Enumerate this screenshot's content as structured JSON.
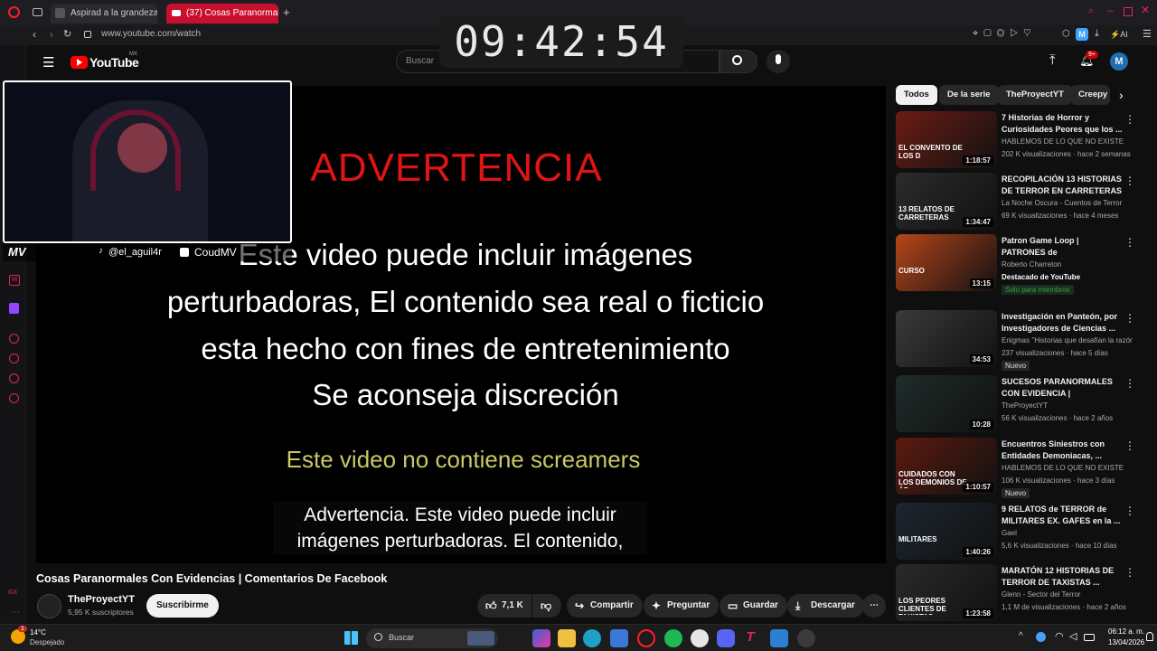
{
  "browser": {
    "tabs": [
      {
        "label": "Aspirad a la grandeza en A",
        "active": false
      },
      {
        "label": "(37) Cosas Paranormales",
        "active": true
      }
    ],
    "url": "www.youtube.com/watch",
    "ai_label": "AI"
  },
  "overlay": {
    "clock": "09:42:54",
    "tiktok_handle": "@el_aguil4r",
    "kick_handle": "CoudMV",
    "logo": "MV"
  },
  "youtube": {
    "logo_text": "YouTube",
    "region": "MX",
    "search_placeholder": "Buscar",
    "notif_count": "9+"
  },
  "player": {
    "warning_title": "ADVERTENCIA",
    "warning_lines": [
      "Este video puede incluir imágenes",
      "perturbadoras, El contenido sea real o ficticio",
      "esta hecho con fines de entretenimiento",
      "Se aconseja discreción"
    ],
    "no_screamers": "Este video no contiene screamers",
    "captions": [
      "Advertencia. Este video puede incluir",
      "imágenes perturbadoras. El contenido,"
    ]
  },
  "video": {
    "title": "Cosas Paranormales Con Evidencias | Comentarios De Facebook",
    "channel": "TheProyectYT",
    "subscribers": "5,95 K suscriptores",
    "subscribe_label": "Suscribirme",
    "likes": "7,1 K",
    "share": "Compartir",
    "ask": "Preguntar",
    "save": "Guardar",
    "download": "Descargar"
  },
  "chips": [
    "Todos",
    "De la serie",
    "TheProyectYT",
    "Creepy"
  ],
  "recommendations": [
    {
      "title": "7 Historias de Horror y Curiosidades Peores que los ...",
      "channel": "HABLEMOS DE LO QUE NO EXISTE",
      "meta": "202 K visualizaciones · hace 2 semanas",
      "duration": "1:18:57",
      "thumb_text": "EL CONVENTO DE LOS D",
      "color": "#6b1d14"
    },
    {
      "title": "RECOPILACIÓN 13 HISTORIAS DE TERROR EN CARRETERAS | ...",
      "channel": "La Noche Oscura - Cuentos de Terror",
      "meta": "69 K visualizaciones · hace 4 meses",
      "duration": "1:34:47",
      "thumb_text": "13 RELATOS DE CARRETERAS",
      "color": "#2b2b2b"
    },
    {
      "title": "Patron Game Loop | PATRONES de PROGRAMACIÓN para ...",
      "channel": "Roberto Charreton",
      "meta": "Destacado de YouTube",
      "duration": "13:15",
      "thumb_text": "CURSO",
      "badge": "Solo para miembros",
      "color": "#b5461a"
    },
    {
      "title": "Investigación en Panteón, por Investigadores de Ciencias ...",
      "channel": "Enigmas \"Historias que desafían la razón\"",
      "meta": "237 visualizaciones · hace 5 días",
      "duration": "34:53",
      "badge": "Nuevo",
      "color": "#3a3a3a"
    },
    {
      "title": "SUCESOS PARANORMALES CON EVIDENCIA | Comentario...",
      "channel": "TheProyectYT",
      "meta": "56 K visualizaciones · hace 2 años",
      "duration": "10:28",
      "color": "#1f2c2a"
    },
    {
      "title": "Encuentros Siniestros con Entidades Demoniacas, ...",
      "channel": "HABLEMOS DE LO QUE NO EXISTE",
      "meta": "106 K visualizaciones · hace 3 días",
      "duration": "1:10:57",
      "thumb_text": "CUIDADOS CON LOS DEMONIOS DE ÁF",
      "badge": "Nuevo",
      "color": "#5c1a10"
    },
    {
      "title": "9 RELATOS de TERROR de MILITARES EX. GAFES en la ...",
      "channel": "Gael",
      "meta": "5,6 K visualizaciones · hace 10 días",
      "duration": "1:40:26",
      "thumb_text": "MILITARES",
      "color": "#1c2630"
    },
    {
      "title": "MARATÓN 12 HISTORIAS DE TERROR DE TAXISTAS ...",
      "channel": "Glenn - Sector del Terror",
      "meta": "1,1 M de visualizaciones · hace 2 años",
      "duration": "1:23:58",
      "thumb_text": "LOS PEORES CLIENTES DE TAXISTAS",
      "color": "#2a2a2a"
    }
  ],
  "taskbar": {
    "temperature": "14°C",
    "weather": "Despejado",
    "search_placeholder": "Buscar",
    "time": "06:12 a. m.",
    "date": "13/04/2026",
    "weather_badge": "1"
  },
  "colors": {
    "accent_red": "#ff0033",
    "youtube_red": "#ff0000",
    "opera_red": "#e0245e"
  }
}
